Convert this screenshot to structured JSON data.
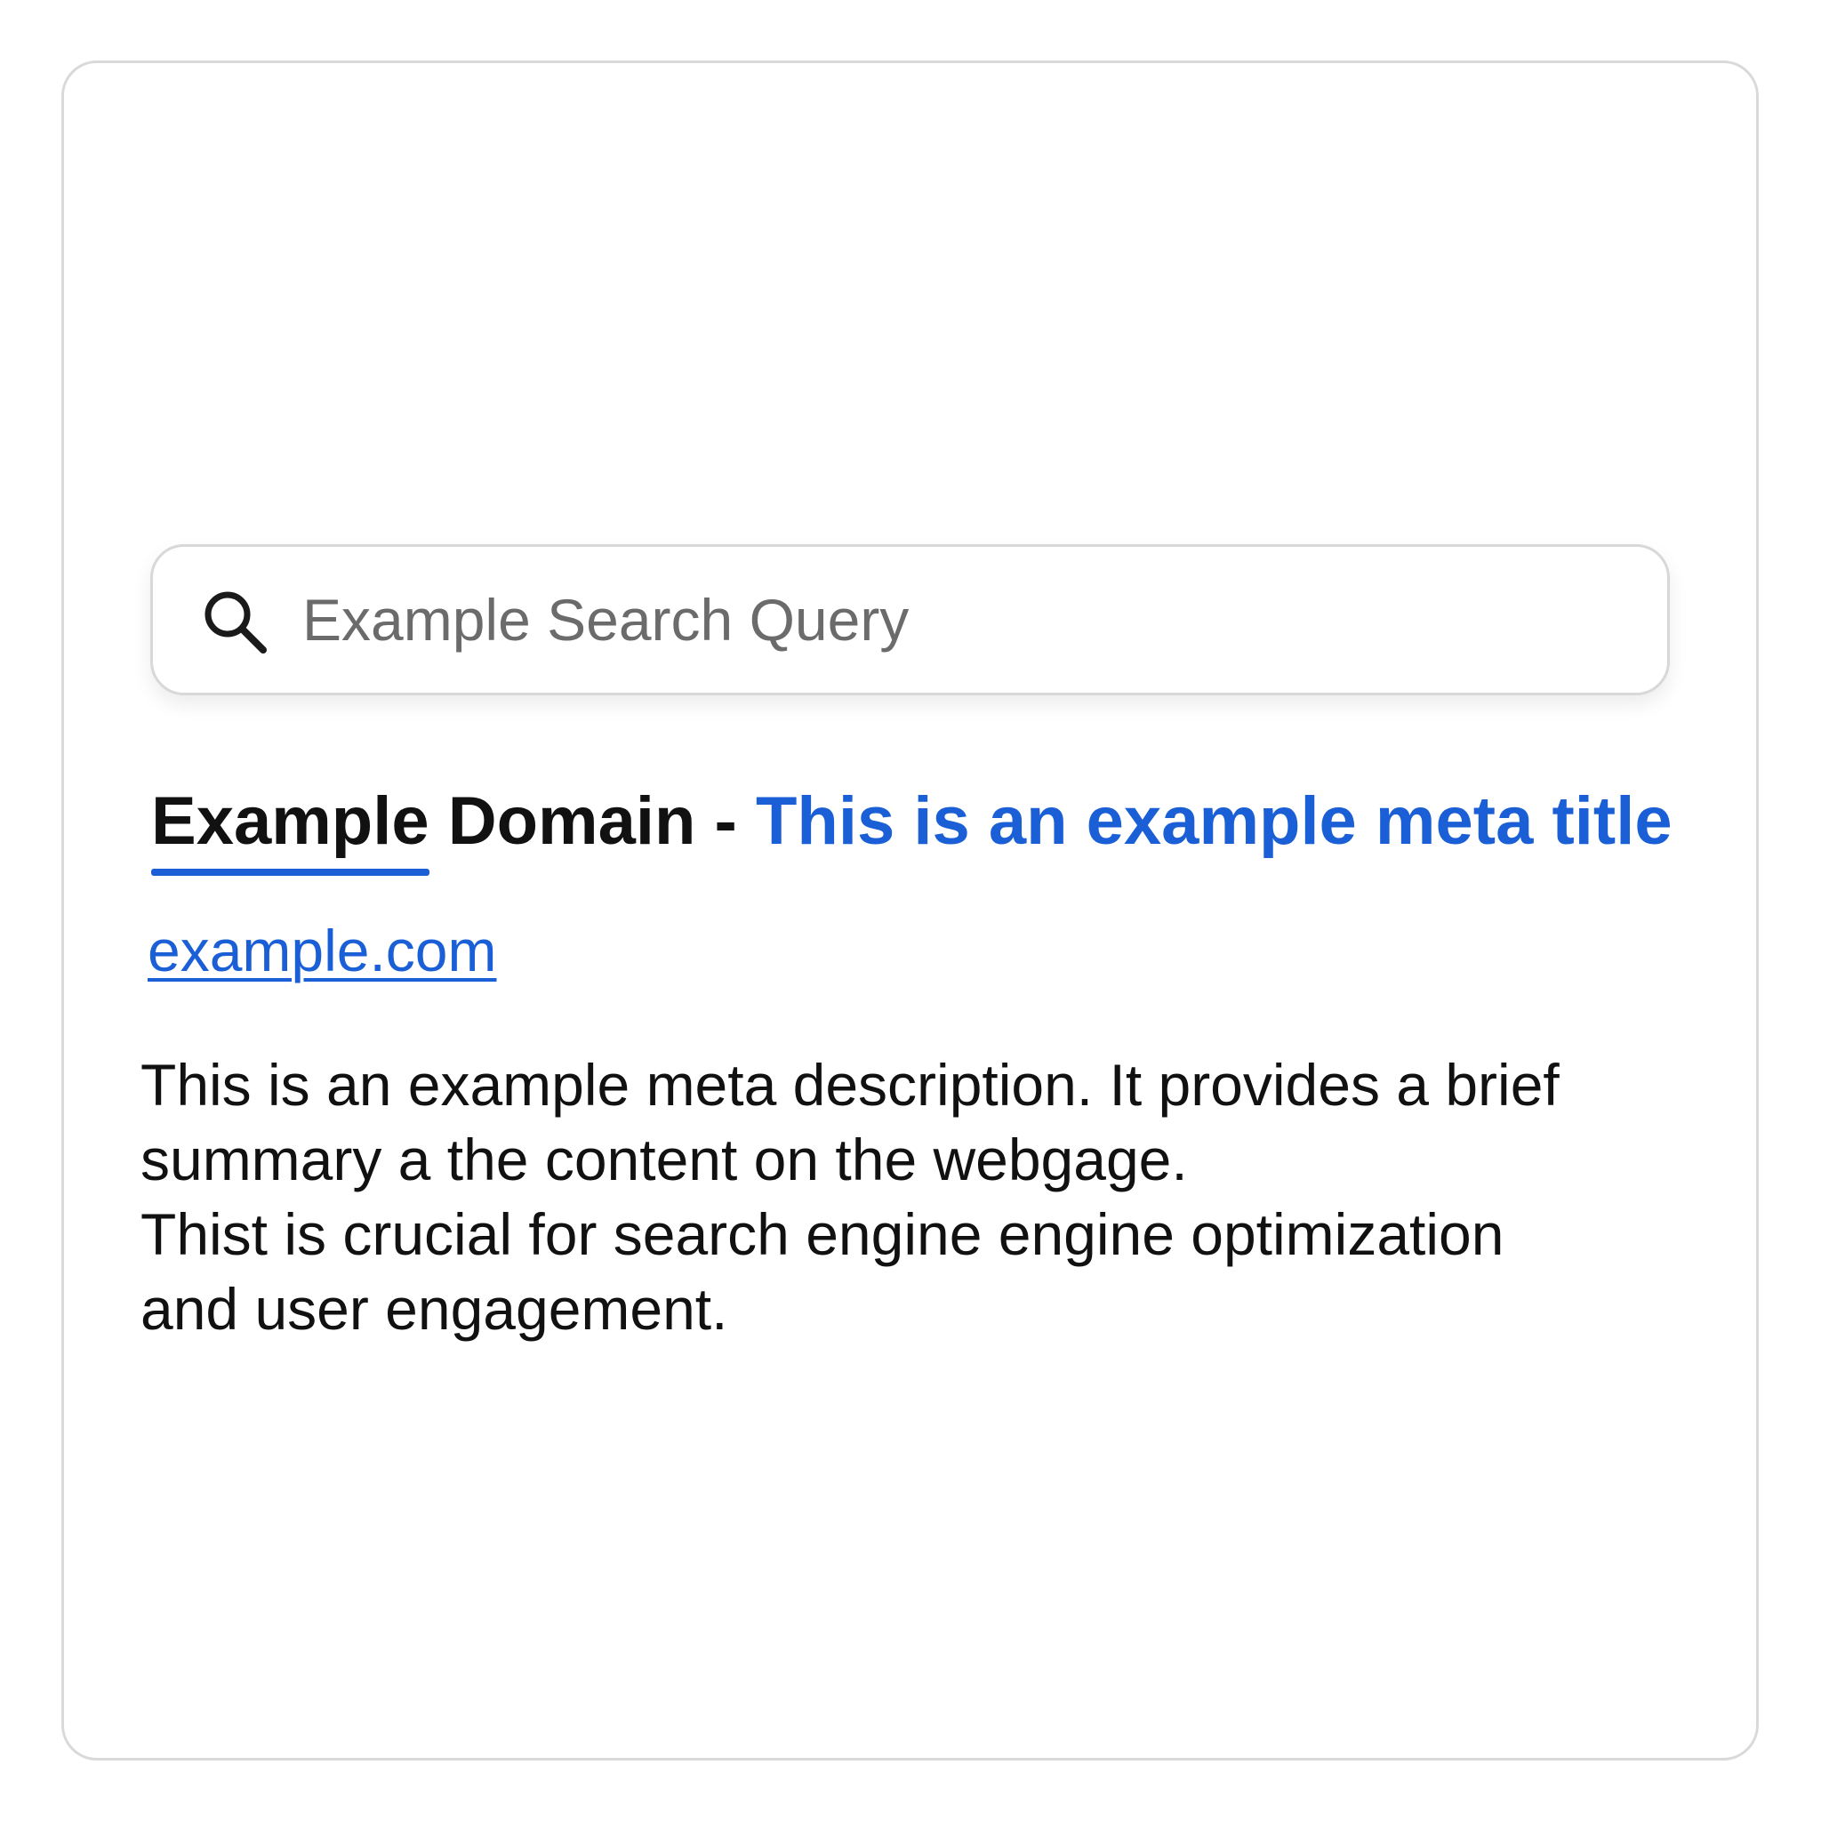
{
  "search": {
    "placeholder": "Example Search Query",
    "icon": "search-icon"
  },
  "result": {
    "title_site_first": "Example",
    "title_site_rest": "Domain -",
    "title_meta": "This is an example meta title",
    "url": "example.com",
    "description_lines": [
      "This is an example meta description. It provides a brief",
      "summary a the content on the webgage.",
      "Thist is crucial for search engine engine optimization",
      "and user engagement."
    ]
  },
  "colors": {
    "link_blue": "#1a5fd6",
    "text_dark": "#111111",
    "placeholder_gray": "#6b6b6b",
    "border_gray": "#d9d9d9",
    "background": "#ffffff"
  }
}
